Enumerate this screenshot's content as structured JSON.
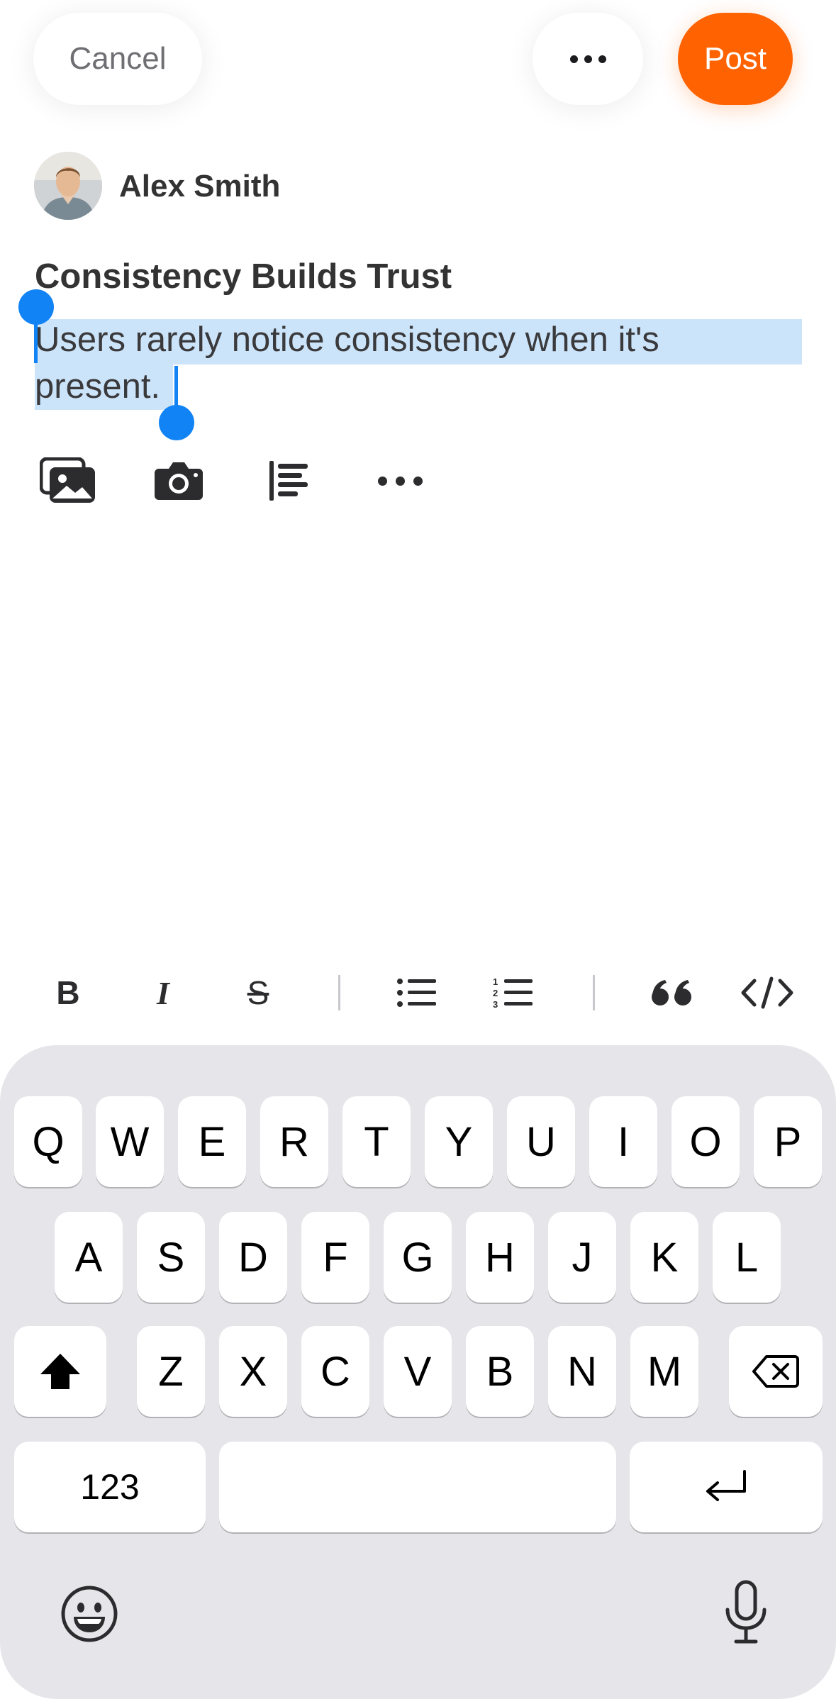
{
  "topbar": {
    "cancel_label": "Cancel",
    "post_label": "Post",
    "more_icon": "ellipsis-icon"
  },
  "author": {
    "name": "Alex Smith",
    "avatar_icon": "user-avatar"
  },
  "post": {
    "title": "Consistency Builds Trust",
    "body_line1": "Users rarely notice consistency when it's",
    "body_line2": "present."
  },
  "media_toolbar": {
    "icons": [
      "photo-gallery-icon",
      "camera-icon",
      "align-icon",
      "more-icon"
    ]
  },
  "format_toolbar": {
    "bold": "B",
    "italic": "I",
    "strike": "S",
    "icons": [
      "bold-icon",
      "italic-icon",
      "strikethrough-icon",
      "bullet-list-icon",
      "numbered-list-icon",
      "quote-icon",
      "code-icon"
    ]
  },
  "keyboard": {
    "row1": [
      "Q",
      "W",
      "E",
      "R",
      "T",
      "Y",
      "U",
      "I",
      "O",
      "P"
    ],
    "row2": [
      "A",
      "S",
      "D",
      "F",
      "G",
      "H",
      "J",
      "K",
      "L"
    ],
    "row3": [
      "Z",
      "X",
      "C",
      "V",
      "B",
      "N",
      "M"
    ],
    "numbers_label": "123",
    "space_label": "",
    "icons": [
      "shift-icon",
      "backspace-icon",
      "return-icon",
      "emoji-icon",
      "microphone-icon"
    ]
  },
  "colors": {
    "accent": "#ff6200",
    "selection": "#cce4fa",
    "handle": "#1183f5",
    "keyboard_bg": "#e5e5ea"
  }
}
